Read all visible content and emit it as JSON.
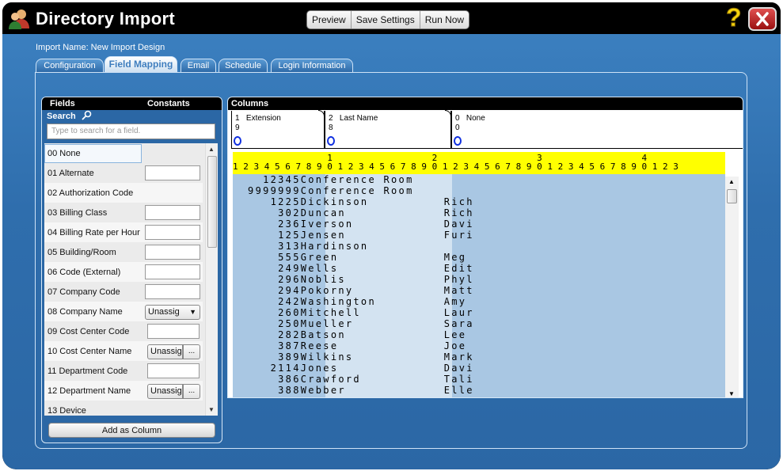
{
  "window": {
    "title": "Directory Import",
    "toolbar": [
      "Preview",
      "Save Settings",
      "Run Now"
    ],
    "help_icon": "question-mark-icon",
    "close_icon": "close-x-icon"
  },
  "import_name": "Import Name: New Import Design",
  "tabs": [
    {
      "label": "Configuration",
      "active": false
    },
    {
      "label": "Field Mapping",
      "active": true
    },
    {
      "label": "Email",
      "active": false
    },
    {
      "label": "Schedule",
      "active": false
    },
    {
      "label": "Login Information",
      "active": false
    }
  ],
  "fields_panel": {
    "header_fields": "Fields",
    "header_constants": "Constants",
    "search_label": "Search",
    "search_placeholder": "Type to search for a field.",
    "items": [
      {
        "label": "00 None",
        "constant": "none",
        "selected": true
      },
      {
        "label": "01 Alternate",
        "constant": "input"
      },
      {
        "label": "02 Authorization Code",
        "constant": "none"
      },
      {
        "label": "03 Billing Class",
        "constant": "input"
      },
      {
        "label": "04 Billing Rate per Hour",
        "constant": "input"
      },
      {
        "label": "05 Building/Room",
        "constant": "input"
      },
      {
        "label": "06 Code (External)",
        "constant": "input"
      },
      {
        "label": "07 Company Code",
        "constant": "input"
      },
      {
        "label": "08 Company Name",
        "constant": "select",
        "value": "Unassig"
      },
      {
        "label": "09 Cost Center Code",
        "constant": "input"
      },
      {
        "label": "10 Cost Center Name",
        "constant": "select-dots",
        "value": "Unassig"
      },
      {
        "label": "11 Department Code",
        "constant": "input"
      },
      {
        "label": "12 Department Name",
        "constant": "select-dots",
        "value": "Unassig"
      },
      {
        "label": "13 Device",
        "constant": "none"
      }
    ],
    "dots_label": "...",
    "add_button": "Add as Column"
  },
  "columns_panel": {
    "header": "Columns",
    "cards": [
      {
        "line1": "1   Extension",
        "line2": "9"
      },
      {
        "line1": "2   Last Name",
        "line2": "8"
      },
      {
        "line1": "0   None",
        "line2": "0"
      }
    ],
    "ruler_top": "                  1                   2                   3                   4",
    "ruler_bottom": "1 2 3 4 5 6 7 8 9 0 1 2 3 4 5 6 7 8 9 0 1 2 3 4 5 6 7 8 9 0 1 2 3 4 5 6 7 8 9 0 1 2 3",
    "rows": [
      "    12345Conference Room         ",
      "  9999999Conference Room         ",
      "     1225Dickinson          Rich",
      "      302Duncan             Rich",
      "      236Iverson            Davi",
      "      125Jensen             Furi",
      "      313Hardinson               ",
      "      555Green              Meg ",
      "      249Wells              Edit",
      "      296Noblis             Phyl",
      "      294Pokorny            Matt",
      "      242Washington         Amy ",
      "      260Mitchell           Laur",
      "      250Mueller            Sara",
      "      282Batson             Lee ",
      "      387Reese              Joe ",
      "      389Wilkins            Mark",
      "     2114Jones              Davi",
      "      386Crawford           Tali",
      "      388Webber             Elle"
    ]
  }
}
